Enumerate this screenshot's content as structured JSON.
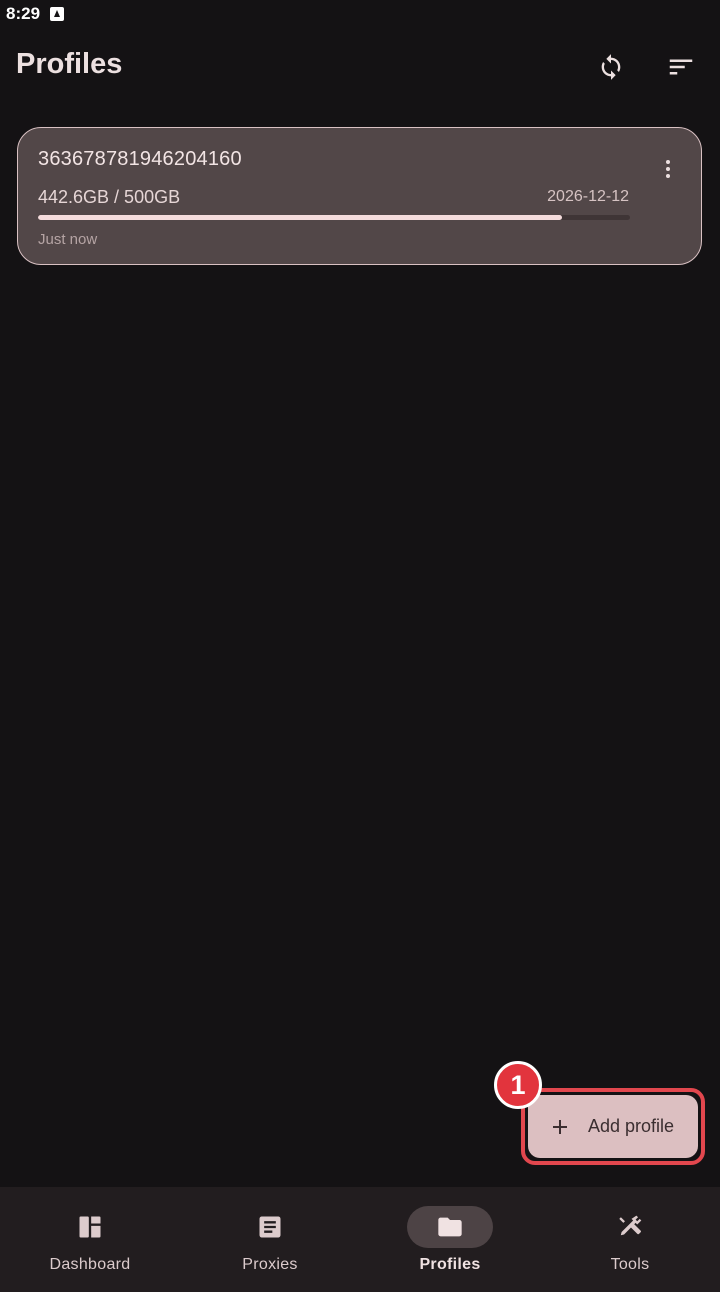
{
  "status_bar": {
    "time": "8:29"
  },
  "app_bar": {
    "title": "Profiles",
    "actions": [
      {
        "icon": "sync-icon"
      },
      {
        "icon": "sort-icon"
      }
    ]
  },
  "profiles": [
    {
      "name": "363678781946204160",
      "usage": "442.6GB / 500GB",
      "expiry": "2026-12-12",
      "usage_fraction": 0.885,
      "updated": "Just now"
    }
  ],
  "fab": {
    "label": "Add profile",
    "icon": "plus-icon",
    "badge": "1"
  },
  "bottom_nav": {
    "active": "Profiles",
    "items": [
      {
        "label": "Dashboard",
        "icon": "dashboard-icon"
      },
      {
        "label": "Proxies",
        "icon": "proxies-icon"
      },
      {
        "label": "Profiles",
        "icon": "folder-icon"
      },
      {
        "label": "Tools",
        "icon": "tools-icon"
      }
    ]
  },
  "colors": {
    "background": "#141214",
    "card": "#524748",
    "accent": "#dcbfc1",
    "highlight": "#e2474e"
  }
}
